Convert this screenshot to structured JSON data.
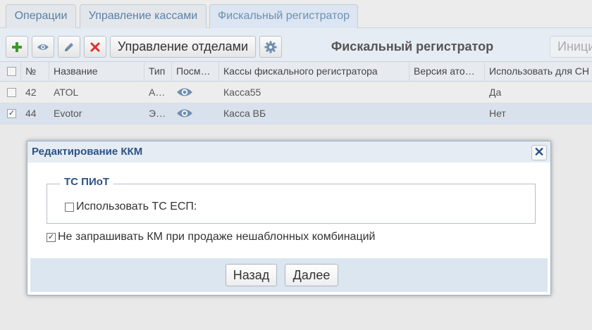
{
  "tabs": [
    {
      "label": "Операции"
    },
    {
      "label": "Управление кассами"
    },
    {
      "label": "Фискальный регистратор"
    }
  ],
  "toolbar": {
    "add_icon": "plus-icon",
    "view_icon": "eye-icon",
    "edit_icon": "pencil-icon",
    "delete_icon": "close-icon",
    "departments_label": "Управление отделами",
    "settings_icon": "gear-icon",
    "title": "Фискальный регистратор",
    "init_label": "Иници"
  },
  "table": {
    "columns": [
      "№",
      "Название",
      "Тип",
      "Посм…",
      "Кассы фискального регистратора",
      "Версия ато…",
      "Использовать для СН"
    ],
    "rows": [
      {
        "checked": false,
        "num": "42",
        "name": "ATOL",
        "type": "А…",
        "cashboxes": "Касса55",
        "version": "",
        "use_for": "Да"
      },
      {
        "checked": true,
        "num": "44",
        "name": "Evotor",
        "type": "Э…",
        "cashboxes": "Касса ВБ",
        "version": "",
        "use_for": "Нет"
      }
    ]
  },
  "dialog": {
    "title": "Редактирование ККМ",
    "close_icon": "close-icon",
    "group_title": "ТС ПИоТ",
    "use_esp_label": "Использовать ТС ЕСП:",
    "use_esp_checked": false,
    "no_km_label": "Не запрашивать КМ при продаже нешаблонных комбинаций",
    "no_km_checked": true,
    "back_label": "Назад",
    "next_label": "Далее"
  },
  "colors": {
    "accent": "#2c5286",
    "add_green": "#3a9a2e",
    "delete_red": "#d9332b",
    "icon_blue": "#6f8fb3"
  }
}
